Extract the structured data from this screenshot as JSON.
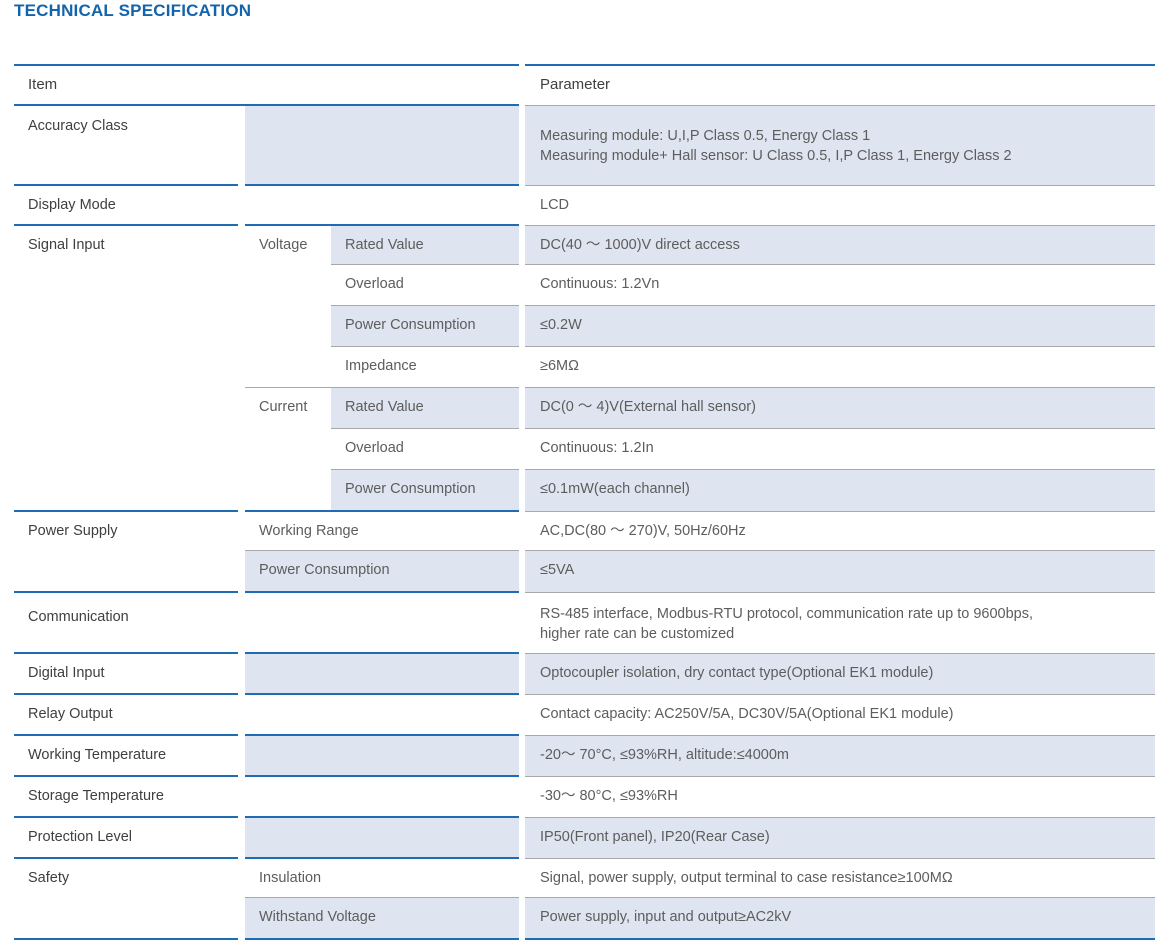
{
  "title": "TECHNICAL SPECIFICATION",
  "colors": {
    "title_blue": "#1464ab",
    "rule_blue": "#1f6cb4",
    "row_fill": "#dee4f0",
    "rule_grey": "#a9a9a9",
    "item_text": "#3f3f3f",
    "param_text": "#5d5d5d"
  },
  "header": {
    "item": "Item",
    "parameter": "Parameter"
  },
  "rows": [
    {
      "item": "Accuracy Class",
      "group": "",
      "sub": "",
      "param_lines": [
        "Measuring module: U,I,P Class 0.5, Energy Class 1",
        "Measuring module+ Hall sensor: U Class 0.5, I,P Class 1, Energy Class 2"
      ]
    },
    {
      "item": "Display Mode",
      "group": "",
      "sub": "",
      "param_lines": [
        "LCD"
      ]
    },
    {
      "item": "Signal Input",
      "group": "Voltage",
      "sub": "Rated Value",
      "param_lines": [
        "DC(40 ～ 1000)V direct access"
      ]
    },
    {
      "item": "",
      "group": "",
      "sub": "Overload",
      "param_lines": [
        "Continuous: 1.2Vn"
      ]
    },
    {
      "item": "",
      "group": "",
      "sub": "Power Consumption",
      "param_lines": [
        "≤0.2W"
      ]
    },
    {
      "item": "",
      "group": "",
      "sub": "Impedance",
      "param_lines": [
        "≥6MΩ"
      ]
    },
    {
      "item": "",
      "group": "Current",
      "sub": "Rated Value",
      "param_lines": [
        "DC(0 ～ 4)V(External hall sensor)"
      ]
    },
    {
      "item": "",
      "group": "",
      "sub": "Overload",
      "param_lines": [
        "Continuous: 1.2In"
      ]
    },
    {
      "item": "",
      "group": "",
      "sub": "Power Consumption",
      "param_lines": [
        "≤0.1mW(each channel)"
      ]
    },
    {
      "item": "Power Supply",
      "group": "",
      "sub": "Working Range",
      "param_lines": [
        "AC,DC(80 ～ 270)V, 50Hz/60Hz"
      ]
    },
    {
      "item": "",
      "group": "",
      "sub": "Power Consumption",
      "param_lines": [
        "≤5VA"
      ]
    },
    {
      "item": "Communication",
      "group": "",
      "sub": "",
      "param_lines": [
        "RS-485 interface, Modbus-RTU protocol, communication rate up to 9600bps,",
        "higher rate can be customized"
      ]
    },
    {
      "item": "Digital Input",
      "group": "",
      "sub": "",
      "param_lines": [
        "Optocoupler isolation, dry contact type(Optional EK1 module)"
      ]
    },
    {
      "item": "Relay Output",
      "group": "",
      "sub": "",
      "param_lines": [
        "Contact capacity: AC250V/5A, DC30V/5A(Optional EK1 module)"
      ]
    },
    {
      "item": "Working Temperature",
      "group": "",
      "sub": "",
      "param_lines": [
        "-20～ 70°C, ≤93%RH, altitude:≤4000m"
      ]
    },
    {
      "item": "Storage Temperature",
      "group": "",
      "sub": "",
      "param_lines": [
        "-30～ 80°C, ≤93%RH"
      ]
    },
    {
      "item": "Protection Level",
      "group": "",
      "sub": "",
      "param_lines": [
        "IP50(Front panel), IP20(Rear Case)"
      ]
    },
    {
      "item": "Safety",
      "group": "",
      "sub": "Insulation",
      "param_lines": [
        "Signal, power supply, output terminal to case resistance≥100MΩ"
      ]
    },
    {
      "item": "",
      "group": "",
      "sub": "Withstand Voltage",
      "param_lines": [
        "Power supply, input and output≥AC2kV"
      ]
    }
  ]
}
